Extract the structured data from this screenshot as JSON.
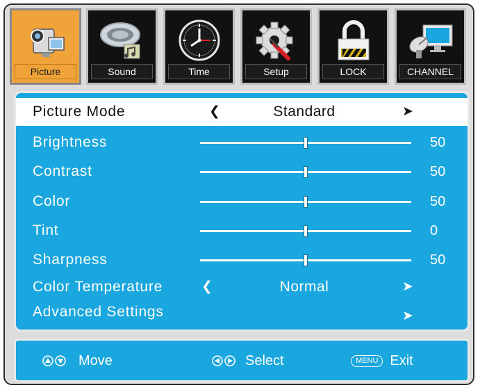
{
  "tabs": [
    {
      "label": "Picture",
      "icon": "camcorder-icon",
      "active": true
    },
    {
      "label": "Sound",
      "icon": "speaker-icon",
      "active": false
    },
    {
      "label": "Time",
      "icon": "clock-icon",
      "active": false
    },
    {
      "label": "Setup",
      "icon": "gear-wrench-icon",
      "active": false
    },
    {
      "label": "LOCK",
      "icon": "padlock-icon",
      "active": false
    },
    {
      "label": "CHANNEL",
      "icon": "satellite-tv-icon",
      "active": false
    }
  ],
  "menu": {
    "picture_mode": {
      "label": "Picture Mode",
      "value": "Standard",
      "left_arrow": "❮",
      "right_arrow": "➤"
    },
    "sliders": [
      {
        "label": "Brightness",
        "value": "50",
        "fraction": 0.5
      },
      {
        "label": "Contrast",
        "value": "50",
        "fraction": 0.5
      },
      {
        "label": "Color",
        "value": "50",
        "fraction": 0.5
      },
      {
        "label": "Tint",
        "value": "0",
        "fraction": 0.5
      },
      {
        "label": "Sharpness",
        "value": "50",
        "fraction": 0.5
      }
    ],
    "color_temperature": {
      "label": "Color Temperature",
      "value": "Normal",
      "left_arrow": "❮",
      "right_arrow": "➤"
    },
    "advanced": {
      "label": "Advanced Settings",
      "arrow": "➤"
    }
  },
  "footer": {
    "move": {
      "glyph": "⓿▼",
      "label": "Move"
    },
    "select": {
      "glyph": "◀▶",
      "label": "Select"
    },
    "exit": {
      "key": "MENU",
      "label": "Exit"
    }
  },
  "colors": {
    "panel": "#1aa6df",
    "active_tab": "#f0a338",
    "tab_bg": "#111111"
  }
}
